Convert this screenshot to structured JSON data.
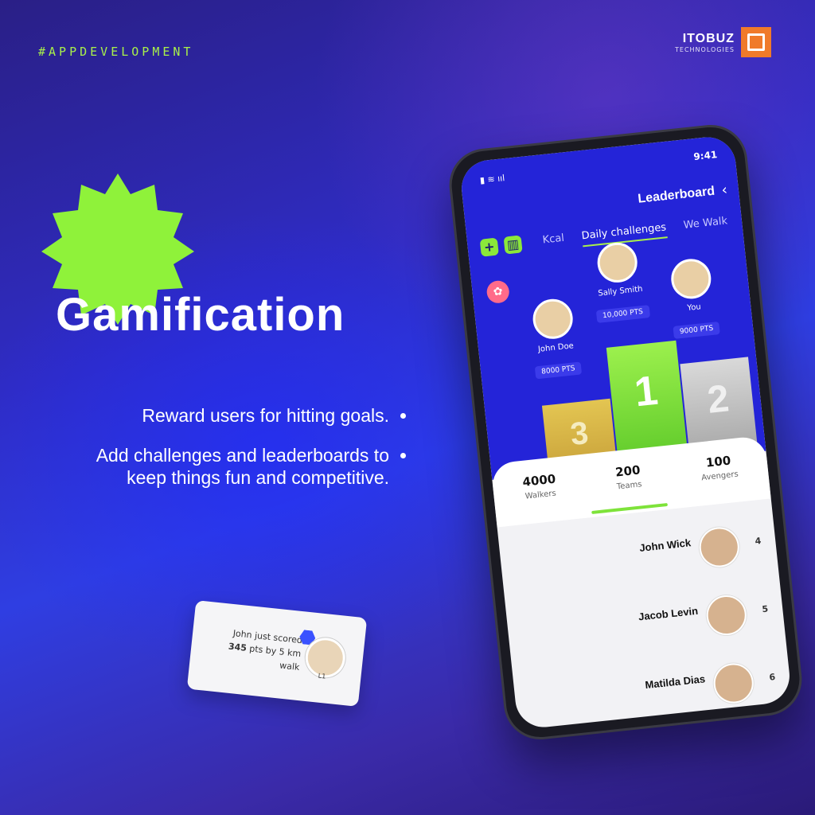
{
  "hashtag": "#APPDEVELOPMENT",
  "brand": {
    "name": "ITOBUZ",
    "sub": "TECHNOLOGIES",
    "color": "#f07a2a"
  },
  "headline": "Gamification",
  "bullets": [
    "Reward users for hitting goals.",
    "Add challenges and leaderboards to keep things fun and competitive."
  ],
  "notification": {
    "text_a": "John just scored",
    "points": "345",
    "text_b": "pts by 5 km walk",
    "level": "L1"
  },
  "phone": {
    "time": "9:41",
    "title": "Leaderboard",
    "tabs": [
      "We Walk",
      "Daily challenges",
      "Kcal"
    ],
    "active_tab": "Daily challenges",
    "podium": [
      {
        "rank": "1",
        "name": "Sally Smith",
        "points": "10,000 PTS"
      },
      {
        "rank": "2",
        "name": "You",
        "points": "9000 PTS"
      },
      {
        "rank": "3",
        "name": "John Doe",
        "points": "8000 PTS"
      }
    ],
    "stats": [
      {
        "value": "100",
        "label": "Avengers"
      },
      {
        "value": "200",
        "label": "Teams"
      },
      {
        "value": "4000",
        "label": "Walkers"
      }
    ],
    "list": [
      {
        "rank": "4",
        "name": "John Wick"
      },
      {
        "rank": "5",
        "name": "Jacob Levin"
      },
      {
        "rank": "6",
        "name": "Matilda Dias"
      }
    ]
  },
  "colors": {
    "accent_green": "#a8f04a",
    "primary_blue": "#2424d8"
  }
}
